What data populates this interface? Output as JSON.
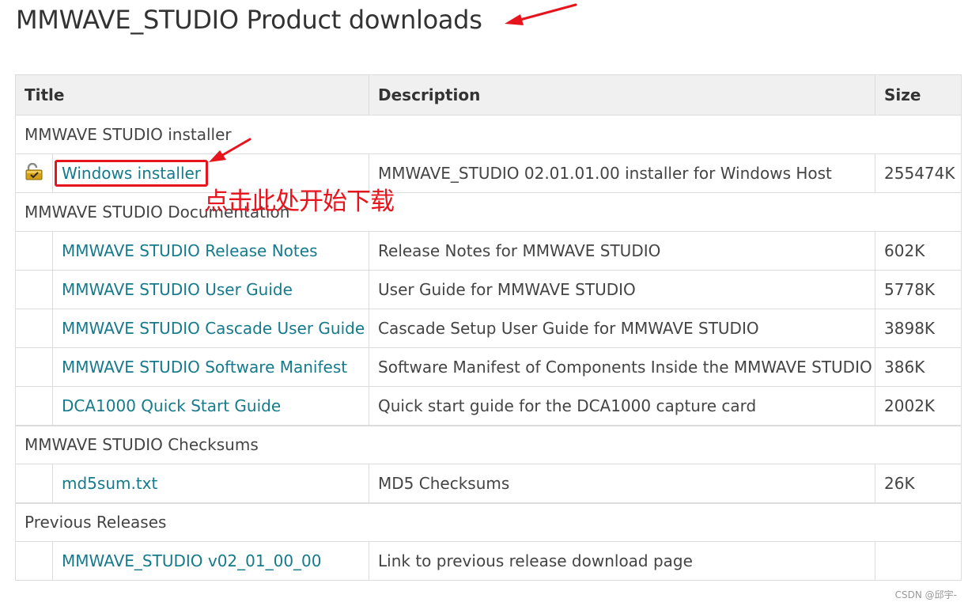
{
  "page": {
    "title": "MMWAVE_STUDIO Product downloads"
  },
  "table": {
    "headers": {
      "title": "Title",
      "description": "Description",
      "size": "Size"
    },
    "sections": [
      {
        "label": "MMWAVE STUDIO installer",
        "rows": [
          {
            "title": "Windows installer",
            "description": "MMWAVE_STUDIO 02.01.01.00 installer for Windows Host",
            "size": "255474K",
            "icon": "lock-icon"
          }
        ]
      },
      {
        "label": "MMWAVE STUDIO Documentation",
        "rows": [
          {
            "title": "MMWAVE STUDIO Release Notes",
            "description": "Release Notes for MMWAVE STUDIO",
            "size": "602K"
          },
          {
            "title": "MMWAVE STUDIO User Guide",
            "description": "User Guide for MMWAVE STUDIO",
            "size": "5778K"
          },
          {
            "title": "MMWAVE STUDIO Cascade User Guide",
            "description": "Cascade Setup User Guide for MMWAVE STUDIO",
            "size": "3898K"
          },
          {
            "title": "MMWAVE STUDIO Software Manifest",
            "description": "Software Manifest of Components Inside the MMWAVE STUDIO",
            "size": "386K"
          },
          {
            "title": "DCA1000 Quick Start Guide",
            "description": "Quick start guide for the DCA1000 capture card",
            "size": "2002K"
          }
        ]
      },
      {
        "label": "MMWAVE STUDIO Checksums",
        "rows": [
          {
            "title": "md5sum.txt",
            "description": "MD5 Checksums",
            "size": "26K"
          }
        ]
      },
      {
        "label": "Previous Releases",
        "rows": [
          {
            "title": "MMWAVE_STUDIO v02_01_00_00",
            "description": "Link to previous release download page",
            "size": ""
          }
        ]
      }
    ]
  },
  "annotation": {
    "text": "点击此处开始下载",
    "color": "#e8141d"
  },
  "watermark": {
    "text": "CSDN @邱宇-"
  },
  "colors": {
    "link": "#157a8c",
    "header_bg": "#f0f0f0",
    "border": "#dcdcdc",
    "annotation_red": "#e8141d",
    "lock_gold": "#d4a017"
  }
}
